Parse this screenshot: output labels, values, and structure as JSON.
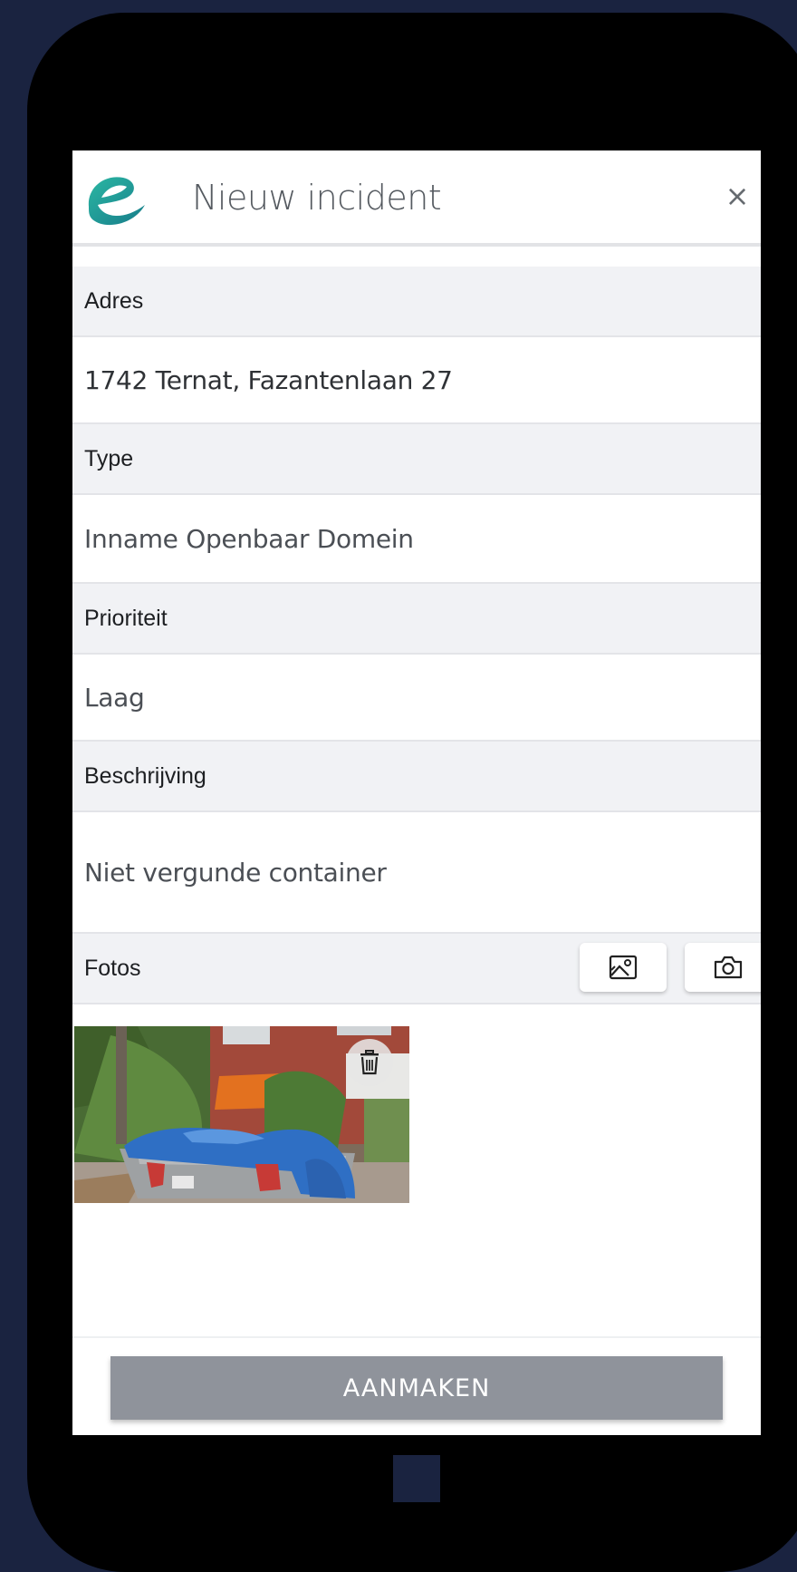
{
  "header": {
    "title": "Nieuw incident",
    "close_label": "×",
    "logo_color": "#1fa79b"
  },
  "form": {
    "address": {
      "label": "Adres",
      "value": "1742 Ternat, Fazantenlaan 27"
    },
    "type": {
      "label": "Type",
      "value": "Inname Openbaar Domein"
    },
    "priority": {
      "label": "Prioriteit",
      "value": "Laag"
    },
    "description": {
      "label": "Beschrijving",
      "value": "Niet vergunde container"
    },
    "photos": {
      "label": "Fotos",
      "gallery_icon": "image-gallery-icon",
      "camera_icon": "camera-icon",
      "delete_icon": "trash-icon"
    }
  },
  "footer": {
    "submit_label": "AANMAKEN",
    "submit_color": "#8f939b"
  }
}
